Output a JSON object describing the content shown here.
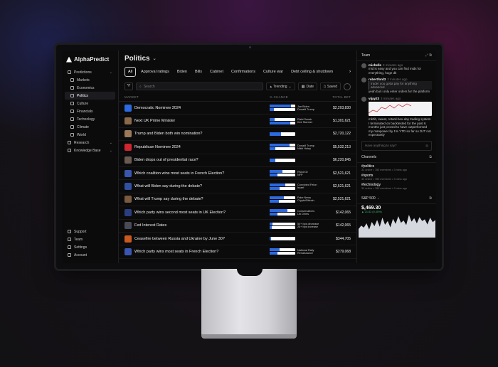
{
  "app": {
    "name": "AlphaPredict"
  },
  "sidebar": {
    "items": [
      {
        "label": "Predictions",
        "expandable": true
      },
      {
        "label": "Markets"
      },
      {
        "label": "Economics"
      },
      {
        "label": "Politics",
        "active": true
      },
      {
        "label": "Culture"
      },
      {
        "label": "Financials"
      },
      {
        "label": "Technology"
      },
      {
        "label": "Climate"
      },
      {
        "label": "World"
      },
      {
        "label": "Research",
        "expandable": true
      },
      {
        "label": "Knowledge Base",
        "expandable": true
      }
    ],
    "footer": [
      {
        "label": "Support"
      },
      {
        "label": "Team"
      },
      {
        "label": "Settings"
      },
      {
        "label": "Account"
      }
    ]
  },
  "header": {
    "title": "Politics"
  },
  "tabs": [
    "All",
    "Approval ratings",
    "Biden",
    "Bills",
    "Cabinet",
    "Confirmations",
    "Culture war",
    "Debt ceiling & shutdown"
  ],
  "toolbar": {
    "search_placeholder": "Search",
    "trending": "Trending",
    "date": "Date",
    "saved": "Saved"
  },
  "table": {
    "headers": {
      "market": "MARKET",
      "chance": "% CHANCE",
      "total": "TOTAL BET"
    },
    "rows": [
      {
        "name": "Democratic Nominee 2024",
        "thumb": "#2d6ae0",
        "chance": [
          0.84,
          0.16
        ],
        "labels": [
          "Joe Biden",
          "Donald Trump"
        ],
        "total": "$2,203,830"
      },
      {
        "name": "Next UK Prime Minister",
        "thumb": "#8a6a4a",
        "chance": [
          0.2,
          0.8
        ],
        "labels": [
          "Rishi Sunak",
          "Keir Starmer"
        ],
        "total": "$1,301,621"
      },
      {
        "name": "Trump and Biden both win nomination?",
        "thumb": "#9a7a5a",
        "chance": [
          0.45
        ],
        "labels": [],
        "total": "$2,720,122"
      },
      {
        "name": "Republican Nominee 2024",
        "thumb": "#d0262f",
        "chance": [
          0.78,
          0.22
        ],
        "labels": [
          "Donald Trump",
          "Nikki Haley"
        ],
        "total": "$5,532,213"
      },
      {
        "name": "Biden drops out of presidential race?",
        "thumb": "#6a5a50",
        "chance": [
          0.22
        ],
        "labels": [],
        "total": "$6,220,845"
      },
      {
        "name": "Which coalition wins most seats in French Election?",
        "thumb": "#3a56b0",
        "chance": [
          0.5,
          0.3
        ],
        "labels": [
          "RN/UXD",
          "NFP"
        ],
        "total": "$2,521,621"
      },
      {
        "name": "What will Biden say during the debate?",
        "thumb": "#3050a0",
        "chance": [
          0.6,
          0.4
        ],
        "labels": [
          "Convicted Felon",
          "Israel"
        ],
        "total": "$2,521,621"
      },
      {
        "name": "What will Trump say during the debate?",
        "thumb": "#7a5a40",
        "chance": [
          0.55,
          0.35
        ],
        "labels": [
          "Fake News",
          "Crypto/Bitcoin"
        ],
        "total": "$2,521,621"
      },
      {
        "name": "Which party wins second most seats in UK Election?",
        "thumb": "#2a3e80",
        "chance": [
          0.7,
          0.3
        ],
        "labels": [
          "Conservatives",
          "Lib Dems"
        ],
        "total": "$142,065"
      },
      {
        "name": "Fed Interest Rates",
        "thumb": "#4a4a55",
        "chance": [
          0.1,
          0.08
        ],
        "labels": [
          "50+ bps decrease",
          "25+ bps increase"
        ],
        "total": "$142,065"
      },
      {
        "name": "Ceasefire between Russia and Ukraine by June 30?",
        "thumb": "#c85a20",
        "chance": [
          0.05
        ],
        "labels": [],
        "total": "$344,705"
      },
      {
        "name": "Which party wins most seats in French Election?",
        "thumb": "#3a56b0",
        "chance": [
          0.4,
          0.3
        ],
        "labels": [
          "National Rally",
          "Renaissance"
        ],
        "total": "$279,068"
      }
    ]
  },
  "team": {
    "title": "Team",
    "messages": [
      {
        "user": "michelle",
        "time": "3 minutes ago",
        "text": "mid is easy and you can find mids for everything, huge dk"
      },
      {
        "user": "robertford3",
        "time": "3 minutes ago",
        "quote": "trader you gotta pay for anything advanced",
        "text": "yeah but i only enter orders for the platform"
      },
      {
        "user": "vijay23",
        "time": "3 minutes ago",
        "text": "mkhh, sweet, retard-box-day trading system I terminated on backtested for the past 6 months just proved to have outperformed my manpower by 1% YTD so far so DJT not expectantly"
      }
    ],
    "input_placeholder": "Have anything to say?"
  },
  "channels": {
    "title": "Channels",
    "items": [
      {
        "name": "#politics",
        "meta": "32 online • 780 members • 3 mins ago"
      },
      {
        "name": "#sports",
        "meta": "32 online • 780 members • 3 mins ago"
      },
      {
        "name": "#technology",
        "meta": "32 online • 780 members • 3 mins ago"
      }
    ]
  },
  "sp500": {
    "title": "S&P 500",
    "price": "$,469.30",
    "change": "▲ 21.62 (0.45%)",
    "series": [
      30,
      42,
      35,
      50,
      28,
      55,
      40,
      62,
      38,
      70,
      45,
      58,
      36,
      66,
      48,
      75,
      52,
      60,
      44,
      80,
      56,
      68,
      50,
      72,
      58,
      64,
      46,
      70,
      54,
      62
    ]
  }
}
